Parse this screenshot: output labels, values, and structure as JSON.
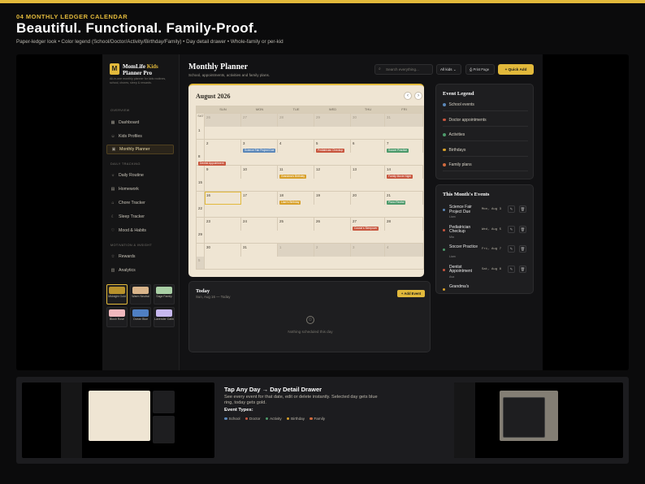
{
  "header": {
    "kicker": "04  MONTHLY LEDGER CALENDAR",
    "headline": "Beautiful. Functional. Family-Proof.",
    "subline": "Paper-ledger look • Color legend (School/Doctor/Activity/Birthday/Family) • Day detail drawer • Whole-family or per-kid"
  },
  "sidebar": {
    "logo_letter": "M",
    "brand_part1": "MomLife ",
    "brand_part2": "Kids",
    "brand_part3": "Planner Pro",
    "brand_desc": "All-in-one monthly planner for kids routines, school, chores, sleep & rewards.",
    "sections": {
      "overview": "OVERVIEW",
      "daily": "DAILY TRACKING",
      "motivation": "MOTIVATION & INSIGHT"
    },
    "items": [
      {
        "label": "Dashboard",
        "icon": "grid-icon"
      },
      {
        "label": "Kids Profiles",
        "icon": "users-icon"
      },
      {
        "label": "Monthly Planner",
        "icon": "calendar-icon"
      },
      {
        "label": "Daily Routine",
        "icon": "sun-icon"
      },
      {
        "label": "Homework",
        "icon": "book-icon"
      },
      {
        "label": "Chore Tracker",
        "icon": "broom-icon"
      },
      {
        "label": "Sleep Tracker",
        "icon": "moon-icon"
      },
      {
        "label": "Mood & Habits",
        "icon": "heart-icon"
      },
      {
        "label": "Rewards",
        "icon": "star-icon"
      },
      {
        "label": "Analytics",
        "icon": "chart-icon"
      }
    ],
    "themes": [
      {
        "label": "Midnight Gold",
        "color": "#b8912b"
      },
      {
        "label": "Warm Neutral",
        "color": "#d9b48a"
      },
      {
        "label": "Sage Family",
        "color": "#a9cfa5"
      },
      {
        "label": "Blush Rose",
        "color": "#f0b8bd"
      },
      {
        "label": "Ocean Blue",
        "color": "#4f7fc2"
      },
      {
        "label": "Lavender Calm",
        "color": "#c7b8ee"
      }
    ]
  },
  "topbar": {
    "title": "Monthly Planner",
    "subtitle": "School, appointments, activities and family plans.",
    "search_placeholder": "Search everything...",
    "kids_filter": "All kids",
    "print_label": "Print Page",
    "quick_add_label": "+  Quick Add"
  },
  "calendar": {
    "month": "August 2026",
    "prev": "‹",
    "next": "›",
    "weekdays": [
      "SUN",
      "MON",
      "TUE",
      "WED",
      "THU",
      "FRI",
      "SAT"
    ],
    "weeks": [
      [
        {
          "d": "26",
          "out": true
        },
        {
          "d": "27",
          "out": true
        },
        {
          "d": "28",
          "out": true
        },
        {
          "d": "29",
          "out": true
        },
        {
          "d": "30",
          "out": true
        },
        {
          "d": "31",
          "out": true
        },
        {
          "d": "1"
        }
      ],
      [
        {
          "d": "2"
        },
        {
          "d": "3",
          "ev": "Science Fair Project Due",
          "c": "#5b87b8"
        },
        {
          "d": "4"
        },
        {
          "d": "5",
          "ev": "Pediatrician Checkup",
          "c": "#c8563e"
        },
        {
          "d": "6"
        },
        {
          "d": "7",
          "ev": "Soccer Practice",
          "c": "#4d9a6b"
        },
        {
          "d": "8",
          "ev": "Dentist Appointment",
          "c": "#c8563e"
        }
      ],
      [
        {
          "d": "9"
        },
        {
          "d": "10"
        },
        {
          "d": "11",
          "ev": "Grandma's Birthday",
          "c": "#d8a02a"
        },
        {
          "d": "12"
        },
        {
          "d": "13"
        },
        {
          "d": "14",
          "ev": "Family Movie Night",
          "c": "#c8563e"
        },
        {
          "d": "15"
        }
      ],
      [
        {
          "d": "16",
          "today": true
        },
        {
          "d": "17"
        },
        {
          "d": "18",
          "ev": "Liam's Birthday",
          "c": "#d8a02a"
        },
        {
          "d": "19"
        },
        {
          "d": "20"
        },
        {
          "d": "21",
          "ev": "Piano Recital",
          "c": "#4d9a6b"
        },
        {
          "d": "22"
        }
      ],
      [
        {
          "d": "23"
        },
        {
          "d": "24"
        },
        {
          "d": "25"
        },
        {
          "d": "26"
        },
        {
          "d": "27",
          "ev": "Cousin's Sleepover",
          "c": "#c8563e"
        },
        {
          "d": "28"
        },
        {
          "d": "29"
        }
      ],
      [
        {
          "d": "30"
        },
        {
          "d": "31"
        },
        {
          "d": "1",
          "out": true
        },
        {
          "d": "2",
          "out": true
        },
        {
          "d": "3",
          "out": true
        },
        {
          "d": "4",
          "out": true
        },
        {
          "d": "5",
          "out": true
        }
      ]
    ]
  },
  "today": {
    "title": "Today",
    "date": "Sun, Aug 16 — Today",
    "add_label": "+ Add Event",
    "empty_icon": "☺",
    "empty_text": "Nothing scheduled this day"
  },
  "legend": {
    "title": "Event Legend",
    "items": [
      {
        "label": "School events",
        "color": "#5b87b8"
      },
      {
        "label": "Doctor appointments",
        "color": "#c8563e"
      },
      {
        "label": "Activities",
        "color": "#4d9a6b"
      },
      {
        "label": "Birthdays",
        "color": "#d8a02a"
      },
      {
        "label": "Family plans",
        "color": "#d16a3e"
      }
    ]
  },
  "month_events": {
    "title": "This Month's Events",
    "items": [
      {
        "title": "Science Fair Project Due",
        "kid": "Liam",
        "date": "Mon, Aug 3",
        "color": "#5b87b8"
      },
      {
        "title": "Pediatrician Checkup",
        "kid": "Mia",
        "date": "Wed, Aug 5",
        "color": "#c8563e"
      },
      {
        "title": "Soccer Practice",
        "kid": "Liam",
        "date": "Fri, Aug 7",
        "color": "#4d9a6b"
      },
      {
        "title": "Dentist Appointment",
        "kid": "Ava",
        "date": "Sat, Aug 8",
        "color": "#c8563e"
      },
      {
        "title": "Grandma's",
        "kid": "",
        "date": "",
        "color": "#d8a02a"
      }
    ]
  },
  "strip": {
    "title": "Tap Any Day → Day Detail Drawer",
    "desc": "See every event for that date, edit or delete instantly. Selected day gets blue ring, today gets gold.",
    "types_title": "Event Types:",
    "types": [
      {
        "label": "School",
        "color": "#5b87b8"
      },
      {
        "label": "Doctor",
        "color": "#c8563e"
      },
      {
        "label": "Activity",
        "color": "#4d9a6b"
      },
      {
        "label": "Birthday",
        "color": "#d8a02a"
      },
      {
        "label": "Family",
        "color": "#d16a3e"
      }
    ]
  }
}
